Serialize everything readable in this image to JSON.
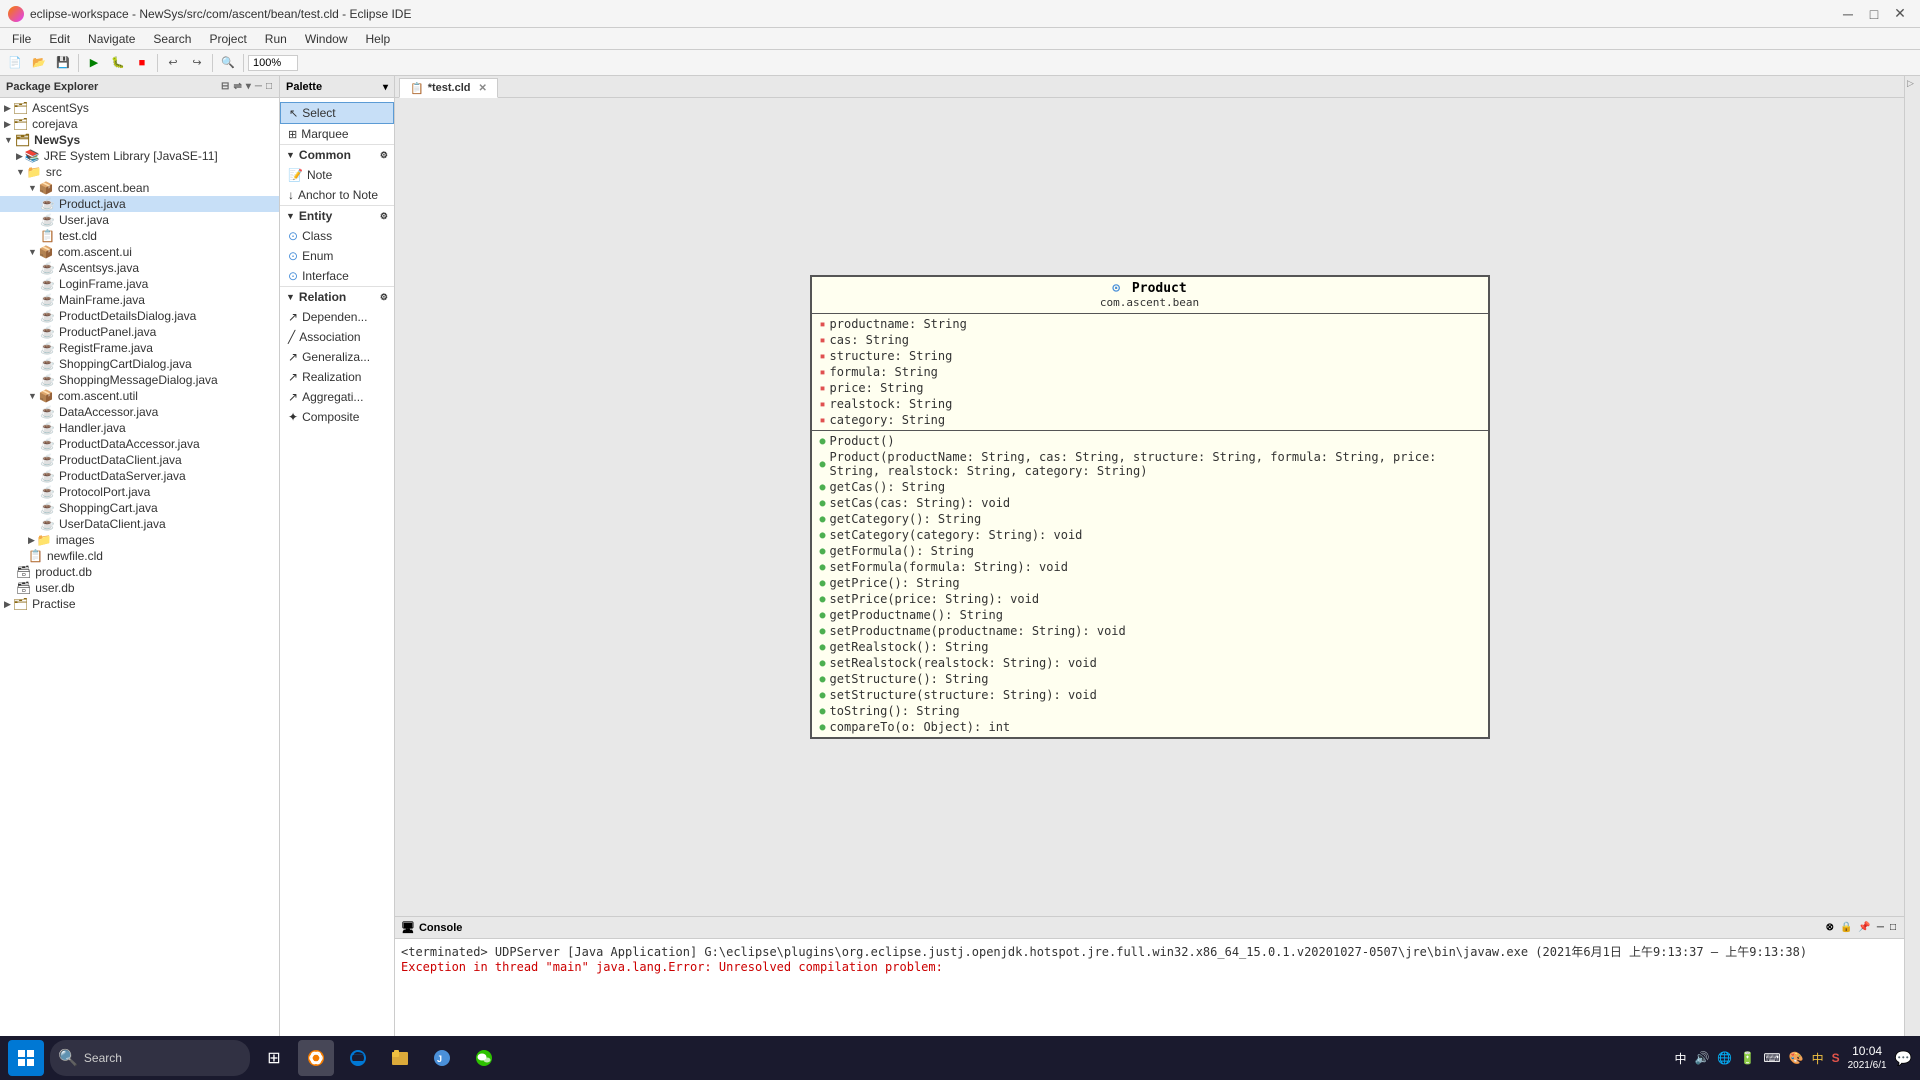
{
  "titleBar": {
    "title": "eclipse-workspace - NewSys/src/com/ascent/bean/test.cld - Eclipse IDE",
    "icon": "eclipse"
  },
  "menuBar": {
    "items": [
      "File",
      "Edit",
      "Navigate",
      "Search",
      "Project",
      "Run",
      "Window",
      "Help"
    ]
  },
  "packageExplorer": {
    "title": "Package Explorer",
    "tree": [
      {
        "label": "AscentSys",
        "level": 0,
        "type": "project",
        "expanded": false
      },
      {
        "label": "corejava",
        "level": 0,
        "type": "project",
        "expanded": false
      },
      {
        "label": "NewSys",
        "level": 0,
        "type": "project",
        "expanded": true
      },
      {
        "label": "JRE System Library [JavaSE-11]",
        "level": 1,
        "type": "jre",
        "expanded": false
      },
      {
        "label": "src",
        "level": 1,
        "type": "folder",
        "expanded": true
      },
      {
        "label": "com.ascent.bean",
        "level": 2,
        "type": "package",
        "expanded": true
      },
      {
        "label": "Product.java",
        "level": 3,
        "type": "java",
        "selected": true
      },
      {
        "label": "User.java",
        "level": 3,
        "type": "java"
      },
      {
        "label": "test.cld",
        "level": 3,
        "type": "cld"
      },
      {
        "label": "com.ascent.ui",
        "level": 2,
        "type": "package",
        "expanded": true
      },
      {
        "label": "Ascentsys.java",
        "level": 3,
        "type": "java"
      },
      {
        "label": "LoginFrame.java",
        "level": 3,
        "type": "java"
      },
      {
        "label": "MainFrame.java",
        "level": 3,
        "type": "java"
      },
      {
        "label": "ProductDetailsDialog.java",
        "level": 3,
        "type": "java"
      },
      {
        "label": "ProductPanel.java",
        "level": 3,
        "type": "java"
      },
      {
        "label": "RegistFrame.java",
        "level": 3,
        "type": "java"
      },
      {
        "label": "ShoppingCartDialog.java",
        "level": 3,
        "type": "java"
      },
      {
        "label": "ShoppingMessageDialog.java",
        "level": 3,
        "type": "java"
      },
      {
        "label": "com.ascent.util",
        "level": 2,
        "type": "package",
        "expanded": true
      },
      {
        "label": "DataAccessor.java",
        "level": 3,
        "type": "java"
      },
      {
        "label": "Handler.java",
        "level": 3,
        "type": "java"
      },
      {
        "label": "ProductDataAccessor.java",
        "level": 3,
        "type": "java"
      },
      {
        "label": "ProductDataClient.java",
        "level": 3,
        "type": "java"
      },
      {
        "label": "ProductDataServer.java",
        "level": 3,
        "type": "java"
      },
      {
        "label": "ProtocolPort.java",
        "level": 3,
        "type": "java"
      },
      {
        "label": "ShoppingCart.java",
        "level": 3,
        "type": "java"
      },
      {
        "label": "UserDataClient.java",
        "level": 3,
        "type": "java"
      },
      {
        "label": "images",
        "level": 2,
        "type": "folder"
      },
      {
        "label": "newfile.cld",
        "level": 2,
        "type": "cld"
      },
      {
        "label": "product.db",
        "level": 1,
        "type": "db"
      },
      {
        "label": "user.db",
        "level": 1,
        "type": "db"
      },
      {
        "label": "Practise",
        "level": 0,
        "type": "project",
        "expanded": false
      }
    ]
  },
  "palette": {
    "title": "Palette",
    "tools": {
      "select": "Select",
      "marquee": "Marquee",
      "sections": [
        {
          "name": "Common",
          "items": [
            {
              "label": "Note",
              "icon": "note"
            },
            {
              "label": "Anchor to Note",
              "icon": "anchor"
            }
          ]
        },
        {
          "name": "Entity",
          "items": [
            {
              "label": "Class",
              "icon": "class"
            },
            {
              "label": "Enum",
              "icon": "enum"
            },
            {
              "label": "Interface",
              "icon": "interface"
            }
          ]
        },
        {
          "name": "Relation",
          "items": [
            {
              "label": "Dependen...",
              "icon": "dependency"
            },
            {
              "label": "Association",
              "icon": "association"
            },
            {
              "label": "Generaliza...",
              "icon": "generalization"
            },
            {
              "label": "Realization",
              "icon": "realization"
            },
            {
              "label": "Aggregati...",
              "icon": "aggregation"
            },
            {
              "label": "Composite",
              "icon": "composite"
            }
          ]
        }
      ]
    }
  },
  "editor": {
    "tab": "*test.cld",
    "tabIcon": "cld"
  },
  "umlDiagram": {
    "className": "Product",
    "packageName": "com.ascent.bean",
    "fields": [
      "productname: String",
      "cas: String",
      "structure: String",
      "formula: String",
      "price: String",
      "realstock: String",
      "category: String"
    ],
    "methods": [
      "Product()",
      "Product(productName: String, cas: String, structure: String, formula: String, price: String, realstock: String, category: String)",
      "getCas(): String",
      "setCas(cas: String): void",
      "getCategory(): String",
      "setCategory(category: String): void",
      "getFormula(): String",
      "setFormula(formula: String): void",
      "getPrice(): String",
      "setPrice(price: String): void",
      "getProductname(): String",
      "setProductname(productname: String): void",
      "getRealstock(): String",
      "setRealstock(realstock: String): void",
      "getStructure(): String",
      "setStructure(structure: String): void",
      "toString(): String",
      "compareTo(o: Object): int"
    ]
  },
  "console": {
    "title": "Console",
    "terminatedLine": "<terminated> UDPServer [Java Application] G:\\eclipse\\plugins\\org.eclipse.justj.openjdk.hotspot.jre.full.win32.x86_64_15.0.1.v20201027-0507\\jre\\bin\\javaw.exe (2021年6月1日 上午9:13:37 – 上午9:13:38)",
    "errorLine": "Exception in thread \"main\" java.lang.Error: Unresolved compilation problem:"
  },
  "taskbar": {
    "time": "10:04",
    "date": "2021/6/1",
    "systemIcons": [
      "中",
      "♪",
      "°",
      "🎤",
      "⌨",
      "🎨",
      "📋",
      "中",
      "S"
    ]
  },
  "zoom": "100%"
}
